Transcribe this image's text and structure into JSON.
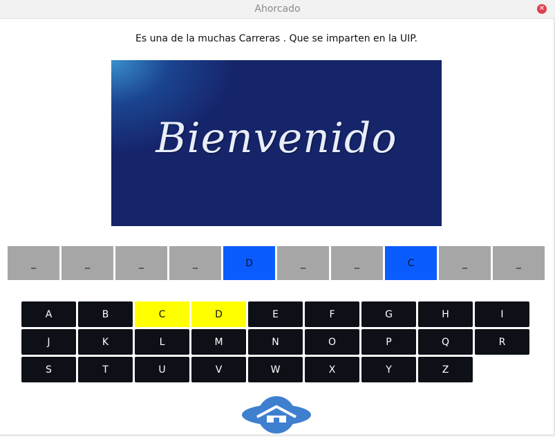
{
  "window": {
    "title": "Ahorcado",
    "close_glyph": "✕"
  },
  "question": "Es una de la muchas Carreras . Que se imparten en la UIP.",
  "banner": {
    "text": "Bienvenido"
  },
  "word": [
    "_",
    "_",
    "_",
    "_",
    "D",
    "_",
    "_",
    "C",
    "_",
    "_"
  ],
  "keyboard": [
    [
      "A",
      "B",
      "C",
      "D",
      "E",
      "F",
      "G",
      "H",
      "I"
    ],
    [
      "J",
      "K",
      "L",
      "M",
      "N",
      "O",
      "P",
      "Q",
      "R"
    ],
    [
      "S",
      "T",
      "U",
      "V",
      "W",
      "X",
      "Y",
      "Z"
    ]
  ],
  "used_letters": [
    "C",
    "D"
  ],
  "colors": {
    "key_bg": "#0d1117",
    "key_used_bg": "#ffff00",
    "slot_bg": "#a6a6a6",
    "slot_revealed_bg": "#0a5cff",
    "home_button": "#3f7fcf"
  },
  "home_button": {
    "icon": "home-icon"
  }
}
